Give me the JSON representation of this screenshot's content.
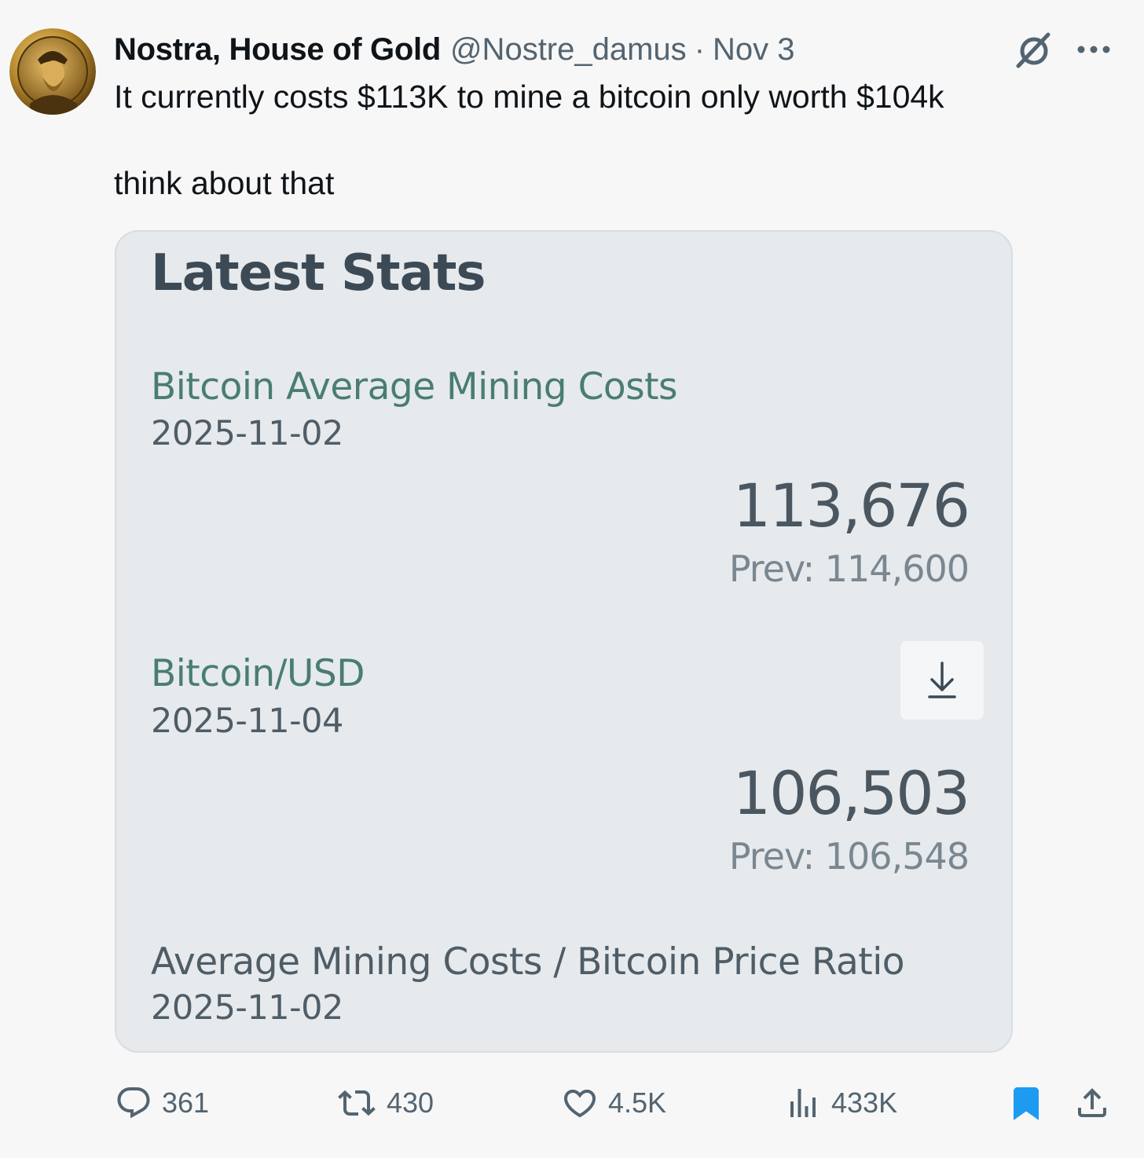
{
  "post": {
    "author_name": "Nostra, House of Gold",
    "author_handle": "@Nostre_damus",
    "separator": "·",
    "date": "Nov 3",
    "text_line1": "It currently costs $113K to mine a bitcoin only worth $104k",
    "text_line2": "think about that"
  },
  "card": {
    "title": "Latest Stats",
    "stats": [
      {
        "label": "Bitcoin Average Mining Costs",
        "date": "2025-11-02",
        "value": "113,676",
        "prev": "Prev: 114,600"
      },
      {
        "label": "Bitcoin/USD",
        "date": "2025-11-04",
        "value": "106,503",
        "prev": "Prev: 106,548"
      },
      {
        "label": "Average Mining Costs / Bitcoin Price Ratio",
        "date": "2025-11-02"
      }
    ]
  },
  "actions": {
    "replies": "361",
    "reposts": "430",
    "likes": "4.5K",
    "views": "433K"
  },
  "icons": {
    "avatar": "gold-coin-portrait",
    "grok": "grok-icon",
    "more": "more-dots-icon",
    "download": "download-arrow-icon",
    "reply": "reply-bubble-icon",
    "repost": "repost-arrows-icon",
    "like": "heart-icon",
    "views": "bar-chart-icon",
    "bookmark": "bookmark-icon",
    "share": "share-icon"
  },
  "colors": {
    "accent_bookmark": "#1d9bf0",
    "card_label_green": "#4a7d72",
    "muted_text": "#536471"
  }
}
